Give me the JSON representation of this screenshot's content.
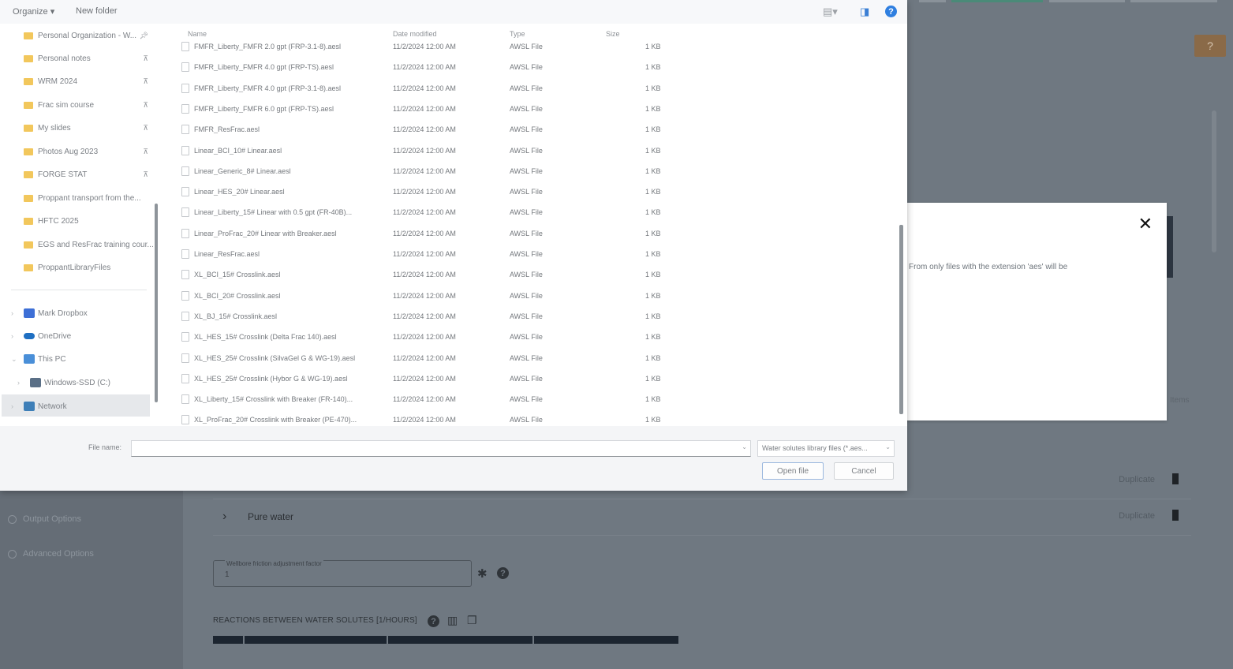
{
  "background": {
    "left_nav": [
      {
        "label": "Output Options"
      },
      {
        "label": "Advanced Options"
      }
    ],
    "rows": [
      {
        "title": "",
        "duplicate_label": "Duplicate"
      },
      {
        "title": "Pure water",
        "duplicate_label": "Duplicate"
      }
    ],
    "wellbore_field": {
      "label": "Wellbore friction adjustment factor",
      "value": "1"
    },
    "section_title": "REACTIONS BETWEEN WATER SOLUTES [1/HOURS]",
    "right_edge_text": "Items"
  },
  "info_modal": {
    "message": "From only files with the extension 'aes' will be"
  },
  "dialog": {
    "toolbar": {
      "organize_label": "Organize ▾",
      "new_folder_label": "New folder"
    },
    "nav_quick": [
      {
        "label": "Personal Organization - W..."
      },
      {
        "label": "Personal notes"
      },
      {
        "label": "WRM 2024"
      },
      {
        "label": "Frac sim course"
      },
      {
        "label": "My slides"
      },
      {
        "label": "Photos Aug 2023"
      },
      {
        "label": "FORGE STAT"
      },
      {
        "label": "Proppant transport from the..."
      },
      {
        "label": "HFTC 2025"
      },
      {
        "label": "EGS and ResFrac training cour..."
      },
      {
        "label": "ProppantLibraryFiles"
      }
    ],
    "nav_locations": [
      {
        "label": "Mark Dropbox"
      },
      {
        "label": "OneDrive"
      },
      {
        "label": "This PC"
      },
      {
        "label": "Windows-SSD (C:)"
      },
      {
        "label": "Network"
      }
    ],
    "columns": {
      "name": "Name",
      "date": "Date modified",
      "type": "Type",
      "size": "Size"
    },
    "files": [
      {
        "name": "FMFR_Liberty_FMFR 2.0 gpt (FRP-3.1-8).aesl",
        "date": "11/2/2024 12:00 AM",
        "type": "AWSL File",
        "size": "1 KB"
      },
      {
        "name": "FMFR_Liberty_FMFR 4.0 gpt (FRP-TS).aesl",
        "date": "11/2/2024 12:00 AM",
        "type": "AWSL File",
        "size": "1 KB"
      },
      {
        "name": "FMFR_Liberty_FMFR 4.0 gpt (FRP-3.1-8).aesl",
        "date": "11/2/2024 12:00 AM",
        "type": "AWSL File",
        "size": "1 KB"
      },
      {
        "name": "FMFR_Liberty_FMFR 6.0 gpt (FRP-TS).aesl",
        "date": "11/2/2024 12:00 AM",
        "type": "AWSL File",
        "size": "1 KB"
      },
      {
        "name": "FMFR_ResFrac.aesl",
        "date": "11/2/2024 12:00 AM",
        "type": "AWSL File",
        "size": "1 KB"
      },
      {
        "name": "Linear_BCI_10# Linear.aesl",
        "date": "11/2/2024 12:00 AM",
        "type": "AWSL File",
        "size": "1 KB"
      },
      {
        "name": "Linear_Generic_8# Linear.aesl",
        "date": "11/2/2024 12:00 AM",
        "type": "AWSL File",
        "size": "1 KB"
      },
      {
        "name": "Linear_HES_20# Linear.aesl",
        "date": "11/2/2024 12:00 AM",
        "type": "AWSL File",
        "size": "1 KB"
      },
      {
        "name": "Linear_Liberty_15# Linear with 0.5 gpt (FR-40B)...",
        "date": "11/2/2024 12:00 AM",
        "type": "AWSL File",
        "size": "1 KB"
      },
      {
        "name": "Linear_ProFrac_20# Linear with Breaker.aesl",
        "date": "11/2/2024 12:00 AM",
        "type": "AWSL File",
        "size": "1 KB"
      },
      {
        "name": "Linear_ResFrac.aesl",
        "date": "11/2/2024 12:00 AM",
        "type": "AWSL File",
        "size": "1 KB"
      },
      {
        "name": "XL_BCI_15# Crosslink.aesl",
        "date": "11/2/2024 12:00 AM",
        "type": "AWSL File",
        "size": "1 KB"
      },
      {
        "name": "XL_BCI_20# Crosslink.aesl",
        "date": "11/2/2024 12:00 AM",
        "type": "AWSL File",
        "size": "1 KB"
      },
      {
        "name": "XL_BJ_15# Crosslink.aesl",
        "date": "11/2/2024 12:00 AM",
        "type": "AWSL File",
        "size": "1 KB"
      },
      {
        "name": "XL_HES_15# Crosslink (Delta Frac 140).aesl",
        "date": "11/2/2024 12:00 AM",
        "type": "AWSL File",
        "size": "1 KB"
      },
      {
        "name": "XL_HES_25# Crosslink (SilvaGel G & WG-19).aesl",
        "date": "11/2/2024 12:00 AM",
        "type": "AWSL File",
        "size": "1 KB"
      },
      {
        "name": "XL_HES_25# Crosslink (Hybor G & WG-19).aesl",
        "date": "11/2/2024 12:00 AM",
        "type": "AWSL File",
        "size": "1 KB"
      },
      {
        "name": "XL_Liberty_15# Crosslink with Breaker (FR-140)...",
        "date": "11/2/2024 12:00 AM",
        "type": "AWSL File",
        "size": "1 KB"
      },
      {
        "name": "XL_ProFrac_20# Crosslink with Breaker (PE-470)...",
        "date": "11/2/2024 12:00 AM",
        "type": "AWSL File",
        "size": "1 KB"
      }
    ],
    "footer": {
      "file_name_label": "File name:",
      "file_name_value": "",
      "file_type_value": "Water solutes library files (*.aes...",
      "open_label": "Open file",
      "cancel_label": "Cancel"
    }
  }
}
